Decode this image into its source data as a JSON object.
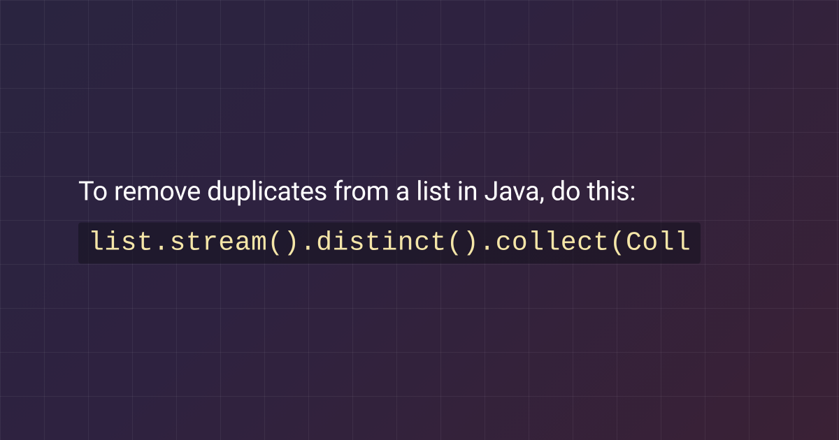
{
  "snippet": {
    "description": "To remove duplicates from a list in Java, do this:",
    "code": "list.stream().distinct().collect(Coll"
  }
}
